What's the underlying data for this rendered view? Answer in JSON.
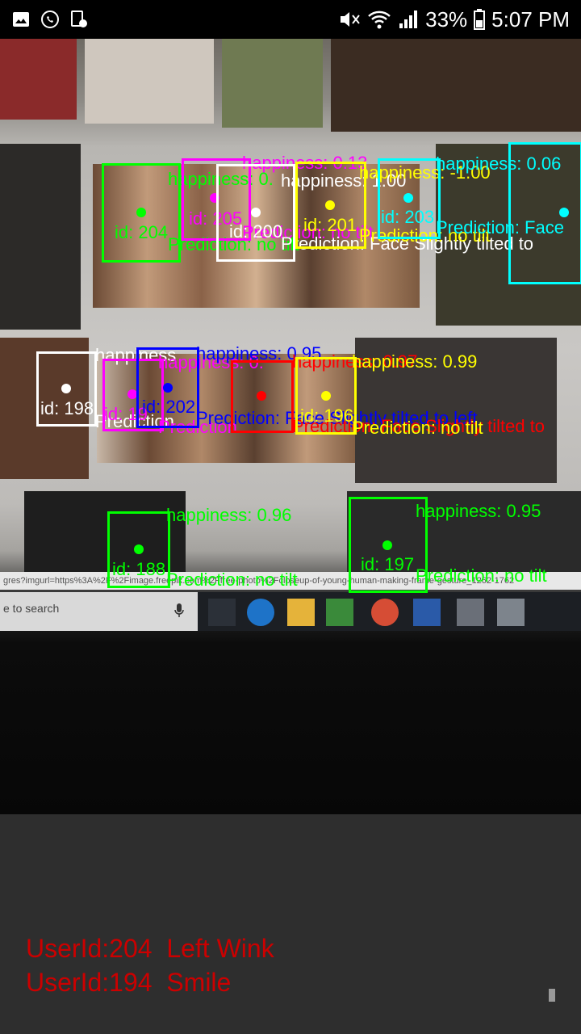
{
  "statusbar": {
    "battery": "33%",
    "time": "5:07 PM",
    "icons": [
      "gallery-icon",
      "whatsapp-icon",
      "screenshot-icon",
      "mute-icon",
      "wifi-icon",
      "signal-icon",
      "battery-icon"
    ]
  },
  "screen": {
    "url_fragment": "gres?imgurl=https%3A%2F%2Fimage.freepik.com%2Ffree-photo%2Fcloseup-of-young-human-making-frame-gesture_1262-1762",
    "search_placeholder": "e to search"
  },
  "detections": [
    {
      "id_label": "id: 204",
      "happiness": "happiness: 0.",
      "prediction": "Prediction: no tilt",
      "color": "#00ff00"
    },
    {
      "id_label": "id: 205",
      "happiness": "happiness: 0.13",
      "prediction": "Prediction: no tilt",
      "color": "#ff00ff"
    },
    {
      "id_label": "id: 200",
      "happiness": "happiness: 1.00",
      "prediction": "Prediction: Face Slightly tilted to",
      "color": "#ffffff"
    },
    {
      "id_label": "id: 201",
      "happiness": "happiness: -1.00",
      "prediction": "Prediction: no tilt",
      "color": "#ffff00"
    },
    {
      "id_label": "id: 203",
      "happiness": "happiness: 0.06",
      "prediction": "Prediction: Face",
      "color": "#00ffff"
    },
    {
      "id_label": "id: 198",
      "happiness": "happiness",
      "prediction": "Prediction",
      "color": "#ffffff"
    },
    {
      "id_label": "id: 202",
      "happiness": "happiness: 0.95",
      "prediction": "Prediction: Face Slightly tilted to left",
      "color": "#0000ff"
    },
    {
      "id_label": "id: 19",
      "happiness": "happiness: 0.",
      "prediction": "Prediction",
      "color": "#ff00ff"
    },
    {
      "id_label": "",
      "happiness": "happiness: 0.97",
      "prediction": "Prediction: Face Slightly tilted to",
      "color": "#ff0000"
    },
    {
      "id_label": "id: 196",
      "happiness": "happiness: 0.99",
      "prediction": "Prediction: no tilt",
      "color": "#ffff00"
    },
    {
      "id_label": "id: 188",
      "happiness": "happiness: 0.96",
      "prediction": "Prediction: no tilt",
      "color": "#00ff00"
    },
    {
      "id_label": "id: 197",
      "happiness": "happiness: 0.95",
      "prediction": "Prediction: no tilt",
      "color": "#00ff00"
    }
  ],
  "gestures": [
    {
      "text": "UserId:204  Left Wink"
    },
    {
      "text": "UserId:194  Smile"
    }
  ]
}
